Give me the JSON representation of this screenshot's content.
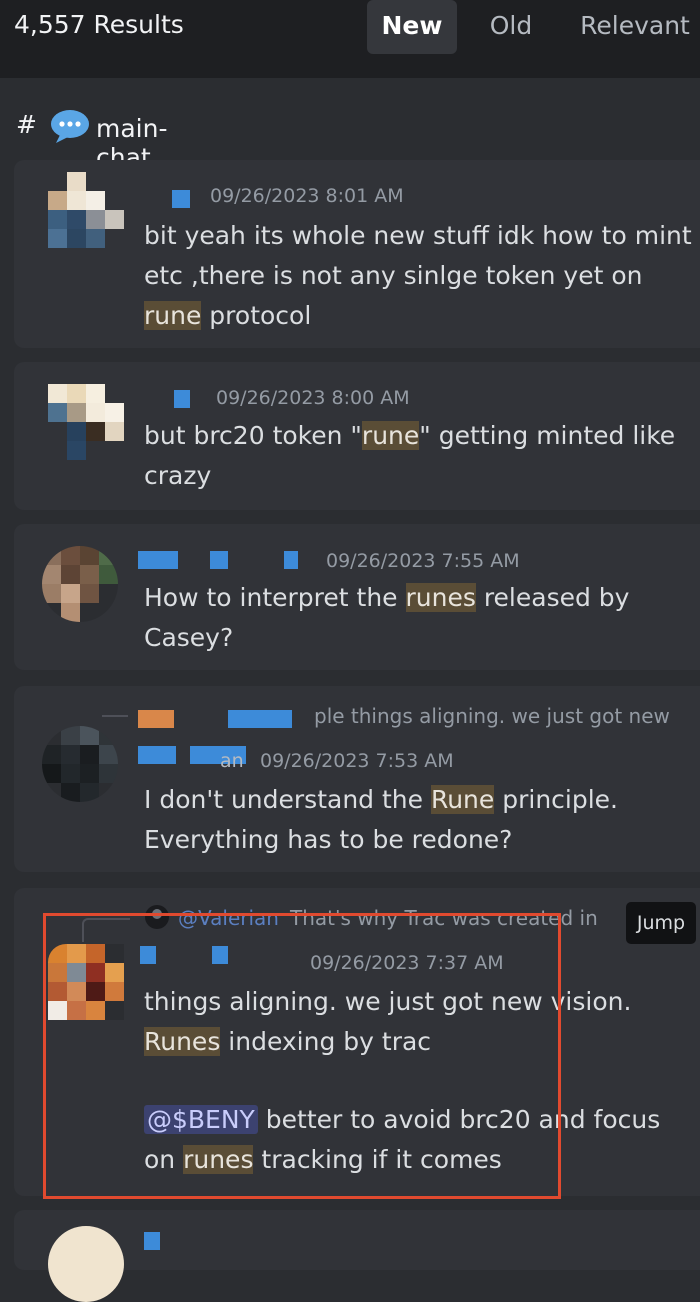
{
  "header": {
    "results_label": "4,557 Results",
    "tabs": [
      {
        "label": "New",
        "active": true
      },
      {
        "label": "Old",
        "active": false
      },
      {
        "label": "Relevant",
        "active": false
      }
    ]
  },
  "channel": {
    "hash": "#",
    "icon": "speech-bubble-icon",
    "name": "main-chat"
  },
  "messages": [
    {
      "timestamp": "09/26/2023 8:01 AM",
      "lines": [
        "bit yeah its whole new stuff idk how to mint",
        "etc ,there is not any sinlge token yet on"
      ],
      "line3_hl": "rune",
      "line3_rest": " protocol"
    },
    {
      "timestamp": "09/26/2023 8:00 AM",
      "line1_pre": "but brc20 token \"",
      "line1_hl": "rune",
      "line1_post": "\" getting minted like",
      "line2": "crazy"
    },
    {
      "timestamp": "09/26/2023 7:55 AM",
      "line1_pre": "How to interpret the ",
      "line1_hl": "runes",
      "line1_post": " released by",
      "line2": "Casey?"
    },
    {
      "reply_preview": "ple things aligning. we just got new",
      "name_fragment": "an",
      "timestamp": "09/26/2023 7:53 AM",
      "line1_pre": "I don't understand the ",
      "line1_hl": "Rune",
      "line1_post": " principle.",
      "line2": "Everything has to be redone?"
    },
    {
      "reply_author": "@Valerian",
      "reply_preview": " That's why Trac was created in",
      "jump_label": "Jump",
      "timestamp": "09/26/2023 7:37 AM",
      "line1": "things aligning. we just got new vision.",
      "line2_hl": "Runes",
      "line2_post": " indexing by trac",
      "mention": "@$BENY",
      "line3_post": " better to avoid brc20 and focus",
      "line4_pre": "on ",
      "line4_hl": "runes",
      "line4_post": " tracking if it comes"
    }
  ],
  "colors": {
    "highlight": "#5a4d36",
    "mention": "#3c4270",
    "accent_name": "#3d8bd9",
    "annotation_box": "#e14a2f"
  }
}
